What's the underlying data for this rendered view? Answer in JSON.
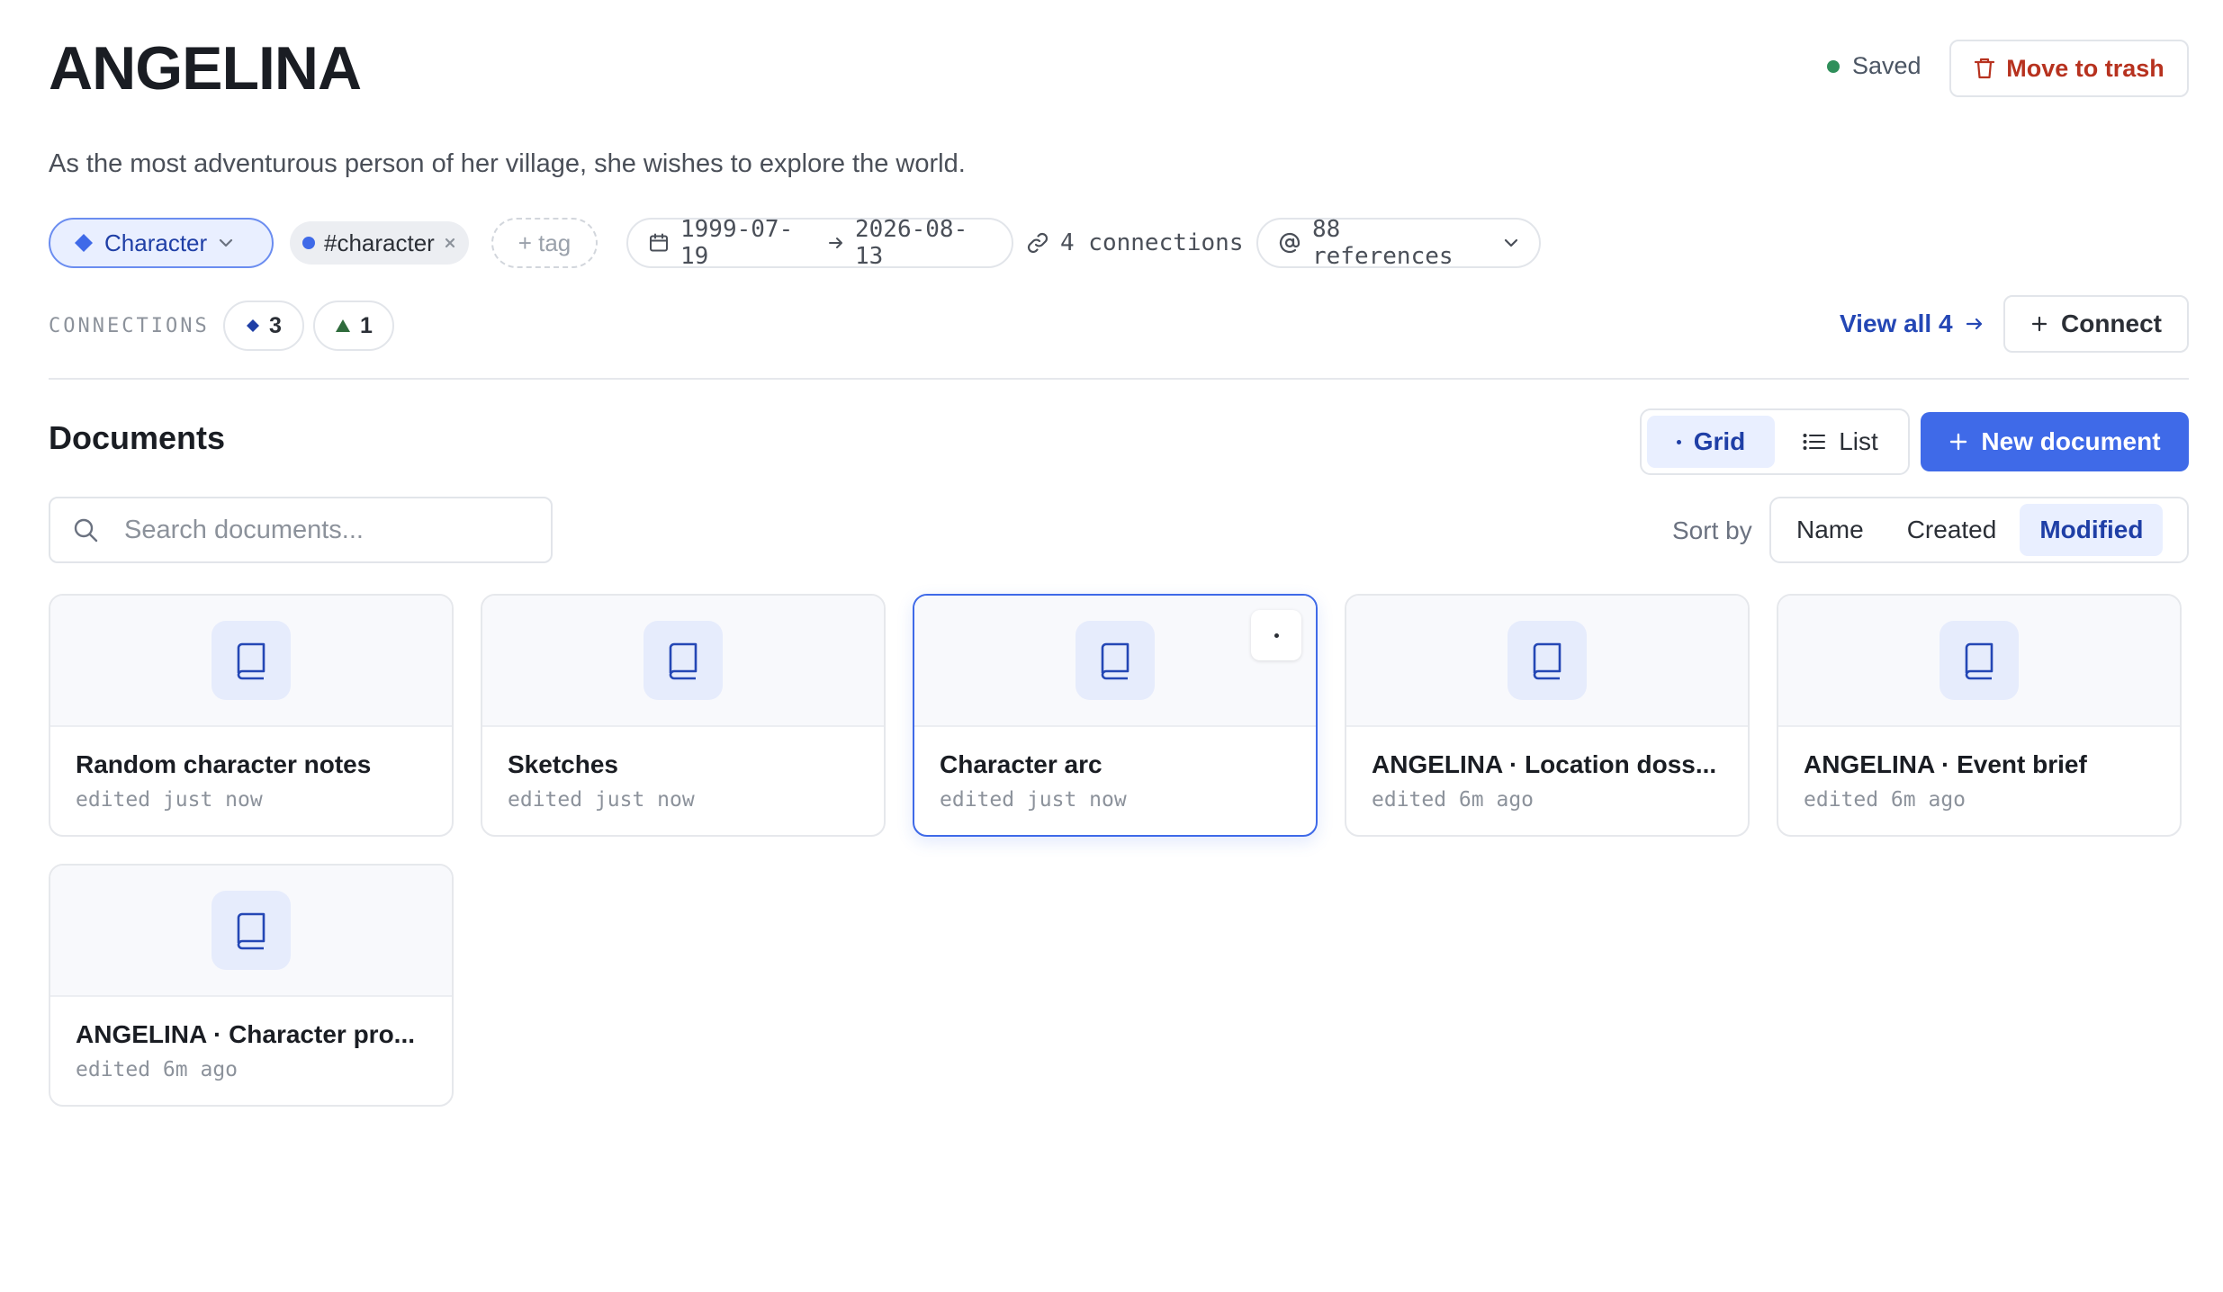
{
  "header": {
    "title": "ANGELINA",
    "saved_label": "Saved",
    "trash_label": "Move to trash",
    "description": "As the most adventurous person of her village, she wishes to explore the world."
  },
  "meta": {
    "type_label": "Character",
    "tag_label": "#character",
    "add_tag_label": "+ tag",
    "date_start": "1999-07-19",
    "date_end": "2026-08-13",
    "connections_label": "4 connections",
    "references_label": "88 references"
  },
  "connections": {
    "label": "CONNECTIONS",
    "character_count": "3",
    "location_count": "1",
    "view_all_label": "View all 4",
    "connect_label": "Connect"
  },
  "documents": {
    "heading": "Documents",
    "grid_label": "Grid",
    "list_label": "List",
    "new_label": "New document",
    "search_placeholder": "Search documents...",
    "sort_label": "Sort by",
    "sort_options": [
      "Name",
      "Created",
      "Modified"
    ],
    "sort_selected": "Modified",
    "cards": [
      {
        "name": "Random character notes",
        "meta": "edited just now"
      },
      {
        "name": "Sketches",
        "meta": "edited just now"
      },
      {
        "name": "Character arc",
        "meta": "edited just now"
      },
      {
        "name": "ANGELINA · Location doss...",
        "meta": "edited 6m ago"
      },
      {
        "name": "ANGELINA · Event brief",
        "meta": "edited 6m ago"
      },
      {
        "name": "ANGELINA · Character pro...",
        "meta": "edited 6m ago"
      }
    ]
  },
  "colors": {
    "accent": "#3f6ae8",
    "saved_dot": "#2f8f5a",
    "trash": "#b7321f",
    "location_marker": "#2f6b3c"
  }
}
